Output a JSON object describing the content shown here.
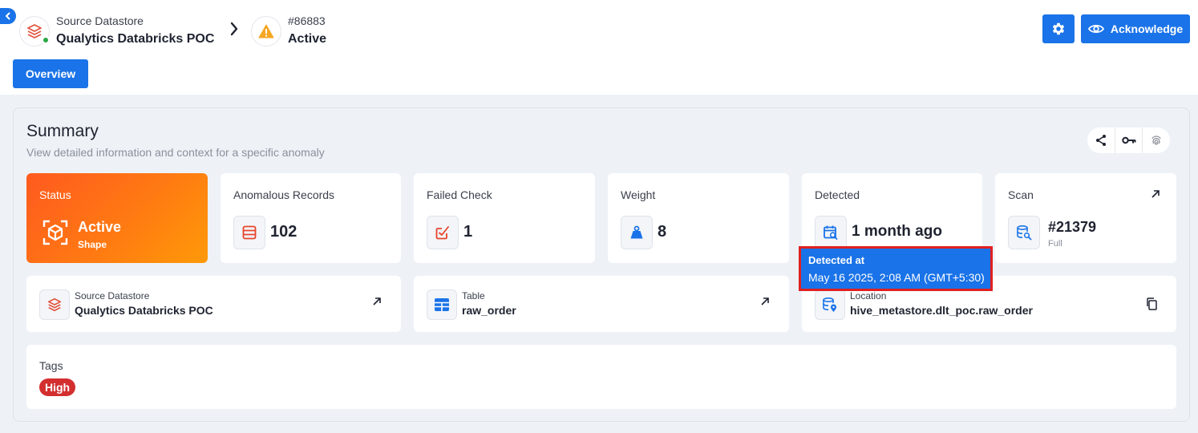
{
  "breadcrumb": {
    "datastore_caption": "Source Datastore",
    "datastore_name": "Qualytics Databricks POC",
    "anomaly_id": "#86883",
    "anomaly_status": "Active"
  },
  "header_actions": {
    "acknowledge_label": "Acknowledge"
  },
  "tabs": [
    {
      "label": "Overview",
      "active": true
    }
  ],
  "summary": {
    "title": "Summary",
    "subtitle": "View detailed information and context for a specific anomaly"
  },
  "tiles": {
    "status": {
      "label": "Status",
      "value": "Active",
      "sub": "Shape"
    },
    "anomalous_records": {
      "label": "Anomalous Records",
      "value": "102"
    },
    "failed_check": {
      "label": "Failed Check",
      "value": "1"
    },
    "weight": {
      "label": "Weight",
      "value": "8"
    },
    "detected": {
      "label": "Detected",
      "value": "1 month ago"
    },
    "scan": {
      "label": "Scan",
      "value": "#21379",
      "sub": "Full"
    }
  },
  "details": {
    "datastore": {
      "label": "Source Datastore",
      "value": "Qualytics Databricks POC"
    },
    "table": {
      "label": "Table",
      "value": "raw_order"
    },
    "location": {
      "label": "Location",
      "value": "hive_metastore.dlt_poc.raw_order"
    }
  },
  "tags": {
    "label": "Tags",
    "items": [
      {
        "label": "High",
        "color": "#d32f2f"
      }
    ]
  },
  "tooltip": {
    "title": "Detected at",
    "value": "May 16 2025, 2:08 AM (GMT+5:30)"
  },
  "colors": {
    "primary": "#1a73e8",
    "status_gradient_start": "#ff5a1f",
    "status_gradient_end": "#ff9a08",
    "tag_high": "#d32f2f",
    "highlight_border": "#e02020",
    "online_dot": "#28a745",
    "warning": "#f5a623"
  },
  "icons": {
    "collapse": "chevron-left-icon",
    "datastore": "databricks-icon",
    "separator": "chevron-right-icon",
    "anomaly": "warning-icon",
    "settings": "gear-icon",
    "acknowledge": "eye-icon",
    "share": "share-icon",
    "key": "key-icon",
    "fingerprint": "fingerprint-icon",
    "records": "list-icon",
    "failed_check": "check-square-icon",
    "weight": "weight-icon",
    "detected": "calendar-search-icon",
    "scan": "database-search-icon",
    "open": "arrow-up-right-icon",
    "table": "table-icon",
    "location": "database-pin-icon",
    "copy": "copy-icon"
  }
}
